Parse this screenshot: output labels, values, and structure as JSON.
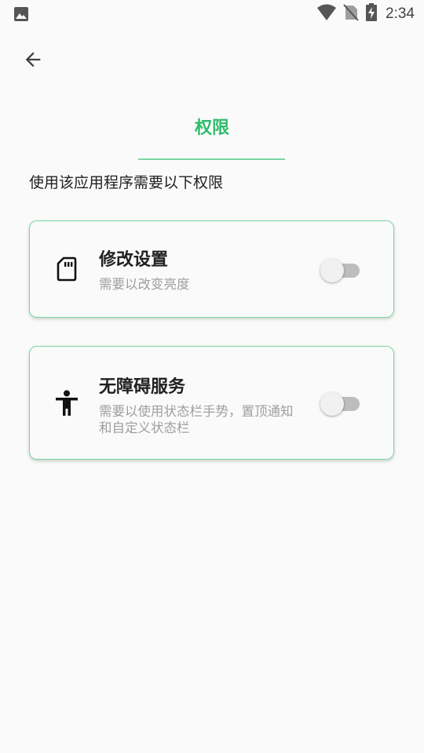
{
  "status_bar": {
    "time": "2:34",
    "icons": [
      "image-icon",
      "wifi-icon",
      "no-sim-icon",
      "battery-charging-icon"
    ]
  },
  "nav": {
    "back_icon": "arrow-left-icon"
  },
  "header": {
    "title": "权限",
    "subtitle": "使用该应用程序需要以下权限"
  },
  "colors": {
    "accent": "#2ebd6b",
    "border": "#7bd7a2"
  },
  "permissions": [
    {
      "icon": "sd-card-icon",
      "title": "修改设置",
      "description": "需要以改变亮度",
      "enabled": false
    },
    {
      "icon": "accessibility-icon",
      "title": "无障碍服务",
      "description": "需要以使用状态栏手势，置顶通知和自定义状态栏",
      "enabled": false
    }
  ]
}
